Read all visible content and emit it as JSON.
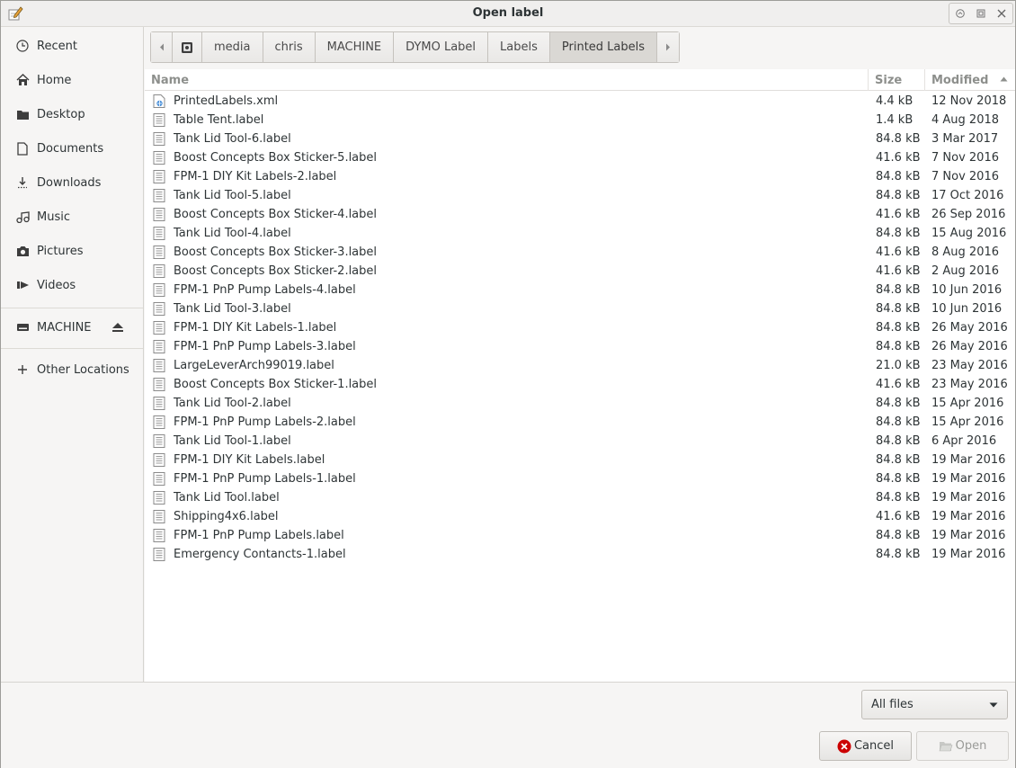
{
  "window": {
    "title": "Open label"
  },
  "sidebar": {
    "items": [
      {
        "label": "Recent",
        "icon": "clock-icon"
      },
      {
        "label": "Home",
        "icon": "home-icon"
      },
      {
        "label": "Desktop",
        "icon": "folder-icon"
      },
      {
        "label": "Documents",
        "icon": "document-icon"
      },
      {
        "label": "Downloads",
        "icon": "download-icon"
      },
      {
        "label": "Music",
        "icon": "music-icon"
      },
      {
        "label": "Pictures",
        "icon": "camera-icon"
      },
      {
        "label": "Videos",
        "icon": "video-icon"
      }
    ],
    "drive": {
      "label": "MACHINE",
      "icon": "drive-icon"
    },
    "other": {
      "label": "Other Locations",
      "icon": "plus-icon"
    }
  },
  "pathbar": {
    "segments": [
      "media",
      "chris",
      "MACHINE",
      "DYMO Label",
      "Labels",
      "Printed Labels"
    ],
    "active": "Printed Labels"
  },
  "columns": {
    "name": "Name",
    "size": "Size",
    "modified": "Modified"
  },
  "files": [
    {
      "name": "PrintedLabels.xml",
      "size": "4.4 kB",
      "modified": "12 Nov 2018"
    },
    {
      "name": "Table Tent.label",
      "size": "1.4 kB",
      "modified": "4 Aug 2018"
    },
    {
      "name": "Tank Lid Tool-6.label",
      "size": "84.8 kB",
      "modified": "3 Mar 2017"
    },
    {
      "name": "Boost Concepts Box Sticker-5.label",
      "size": "41.6 kB",
      "modified": "7 Nov 2016"
    },
    {
      "name": "FPM-1 DIY Kit Labels-2.label",
      "size": "84.8 kB",
      "modified": "7 Nov 2016"
    },
    {
      "name": "Tank Lid Tool-5.label",
      "size": "84.8 kB",
      "modified": "17 Oct 2016"
    },
    {
      "name": "Boost Concepts Box Sticker-4.label",
      "size": "41.6 kB",
      "modified": "26 Sep 2016"
    },
    {
      "name": "Tank Lid Tool-4.label",
      "size": "84.8 kB",
      "modified": "15 Aug 2016"
    },
    {
      "name": "Boost Concepts Box Sticker-3.label",
      "size": "41.6 kB",
      "modified": "8 Aug 2016"
    },
    {
      "name": "Boost Concepts Box Sticker-2.label",
      "size": "41.6 kB",
      "modified": "2 Aug 2016"
    },
    {
      "name": "FPM-1 PnP Pump Labels-4.label",
      "size": "84.8 kB",
      "modified": "10 Jun 2016"
    },
    {
      "name": "Tank Lid Tool-3.label",
      "size": "84.8 kB",
      "modified": "10 Jun 2016"
    },
    {
      "name": "FPM-1 DIY Kit Labels-1.label",
      "size": "84.8 kB",
      "modified": "26 May 2016"
    },
    {
      "name": "FPM-1 PnP Pump Labels-3.label",
      "size": "84.8 kB",
      "modified": "26 May 2016"
    },
    {
      "name": "LargeLeverArch99019.label",
      "size": "21.0 kB",
      "modified": "23 May 2016"
    },
    {
      "name": "Boost Concepts Box Sticker-1.label",
      "size": "41.6 kB",
      "modified": "23 May 2016"
    },
    {
      "name": "Tank Lid Tool-2.label",
      "size": "84.8 kB",
      "modified": "15 Apr 2016"
    },
    {
      "name": "FPM-1 PnP Pump Labels-2.label",
      "size": "84.8 kB",
      "modified": "15 Apr 2016"
    },
    {
      "name": "Tank Lid Tool-1.label",
      "size": "84.8 kB",
      "modified": "6 Apr 2016"
    },
    {
      "name": "FPM-1 DIY Kit Labels.label",
      "size": "84.8 kB",
      "modified": "19 Mar 2016"
    },
    {
      "name": "FPM-1 PnP Pump Labels-1.label",
      "size": "84.8 kB",
      "modified": "19 Mar 2016"
    },
    {
      "name": "Tank Lid Tool.label",
      "size": "84.8 kB",
      "modified": "19 Mar 2016"
    },
    {
      "name": "Shipping4x6.label",
      "size": "41.6 kB",
      "modified": "19 Mar 2016"
    },
    {
      "name": "FPM-1 PnP Pump Labels.label",
      "size": "84.8 kB",
      "modified": "19 Mar 2016"
    },
    {
      "name": "Emergency Contancts-1.label",
      "size": "84.8 kB",
      "modified": "19 Mar 2016"
    }
  ],
  "filter": {
    "label": "All files"
  },
  "buttons": {
    "cancel": "Cancel",
    "open": "Open"
  },
  "colors": {
    "cancel_icon": "#cc0000",
    "text": "#2e3436",
    "header_text": "#8d8f8c"
  }
}
